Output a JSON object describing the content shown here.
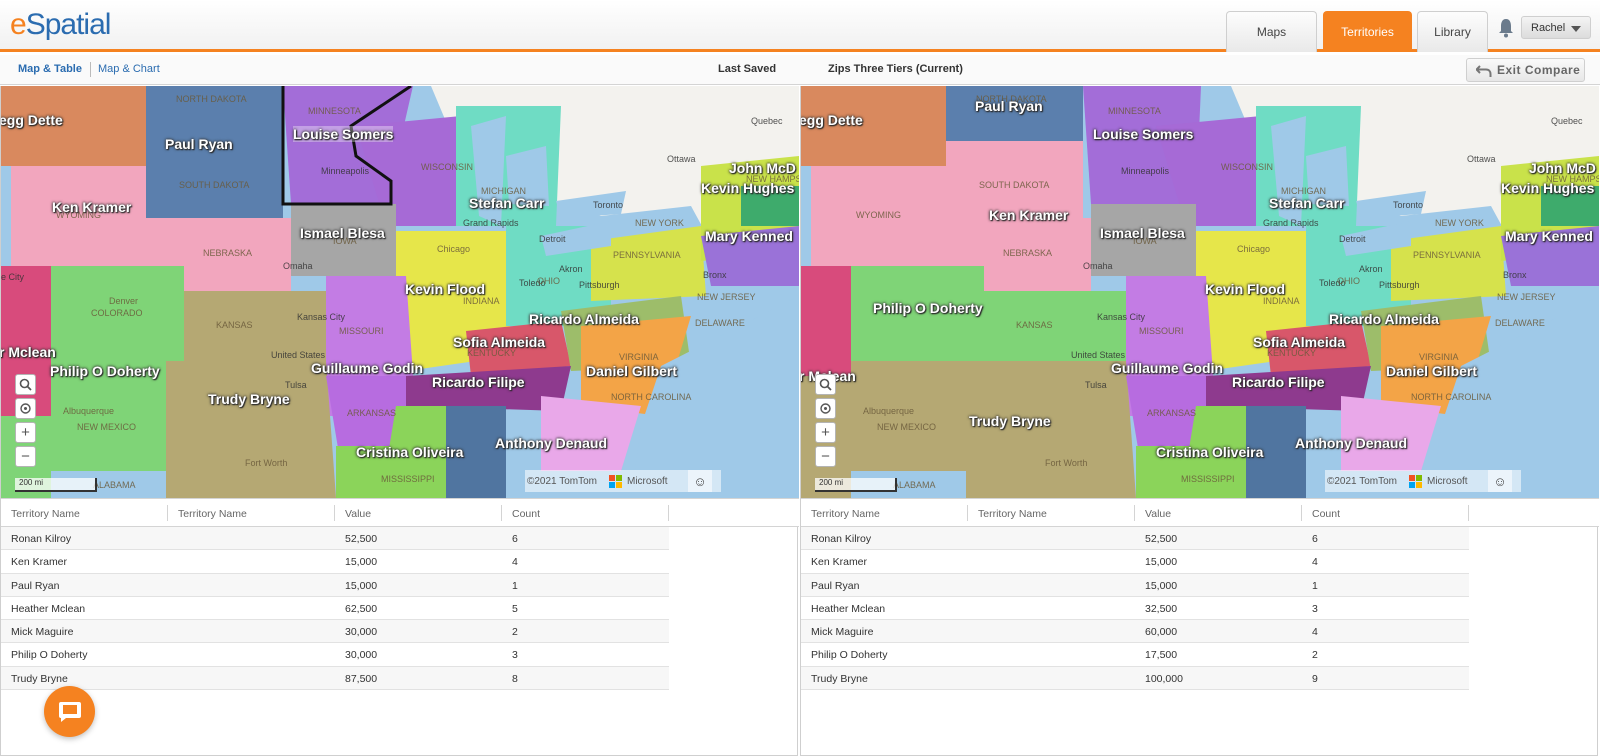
{
  "app": {
    "logo_part1": "e",
    "logo_part2": "Spatial",
    "brand_orange": "#f58220",
    "brand_blue": "#2b6cb0"
  },
  "nav": {
    "maps": "Maps",
    "territories": "Territories",
    "library": "Library",
    "active": "Territories",
    "user": "Rachel"
  },
  "subbar": {
    "tab_map_table": "Map & Table",
    "tab_map_chart": "Map & Chart",
    "last_saved": "Last Saved",
    "scenario": "Zips Three Tiers (Current)",
    "exit_compare": "Exit Compare"
  },
  "map": {
    "labels": [
      "egg Dette",
      "Paul Ryan",
      "Louise Somers",
      "Ken Kramer",
      "Stefan Carr",
      "Ismael Blesa",
      "Kevin Flood",
      "John McD",
      "Kevin Hughes",
      "Mary Kenned",
      "Ricardo Almeida",
      "Sofia Almeida",
      "r Mclean",
      "Philip O Doherty",
      "Guillaume Godin",
      "Ricardo Filipe",
      "Daniel Gilbert",
      "Trudy Bryne",
      "Anthony Denaud",
      "Cristina Oliveira"
    ],
    "cities": [
      "NORTH DAKOTA",
      "MINNESOTA",
      "SOUTH DAKOTA",
      "WYOMING",
      "Minneapolis",
      "WISCONSIN",
      "MICHIGAN",
      "Grand Rapids",
      "Detroit",
      "Toronto",
      "Ottawa",
      "Quebec",
      "NEW YORK",
      "NEW HAMPSHIRE",
      "NEBRASKA",
      "IOWA",
      "Omaha",
      "Chicago",
      "Toledo",
      "Akron",
      "OHIO",
      "PENNSYLVANIA",
      "Pittsburgh",
      "Bronx",
      "NEW JERSEY",
      "Denver",
      "COLORADO",
      "KANSAS",
      "Kansas City",
      "MISSOURI",
      "INDIANA",
      "KENTUCKY",
      "DELAWARE",
      "VIRGINIA",
      "United States",
      "Tulsa",
      "NORTH CAROLINA",
      "ARKANSAS",
      "Albuquerque",
      "NEW MEXICO",
      "Fort Worth",
      "MISSISSIPPI",
      "ALABAMA",
      "e City"
    ],
    "attribution": "©2021 TomTom",
    "microsoft": "Microsoft",
    "scale": "200 mi",
    "zoom_in": "+",
    "zoom_out": "−"
  },
  "table_headers": [
    "Territory Name",
    "Territory Name",
    "Value",
    "Count"
  ],
  "left_table": [
    {
      "name": "Ronan Kilroy",
      "value": "52,500",
      "count": "6"
    },
    {
      "name": "Ken Kramer",
      "value": "15,000",
      "count": "4"
    },
    {
      "name": "Paul Ryan",
      "value": "15,000",
      "count": "1"
    },
    {
      "name": "Heather Mclean",
      "value": "62,500",
      "count": "5"
    },
    {
      "name": "Mick Maguire",
      "value": "30,000",
      "count": "2"
    },
    {
      "name": "Philip O Doherty",
      "value": "30,000",
      "count": "3"
    },
    {
      "name": "Trudy Bryne",
      "value": "87,500",
      "count": "8"
    }
  ],
  "right_table": [
    {
      "name": "Ronan Kilroy",
      "value": "52,500",
      "count": "6"
    },
    {
      "name": "Ken Kramer",
      "value": "15,000",
      "count": "4"
    },
    {
      "name": "Paul Ryan",
      "value": "15,000",
      "count": "1"
    },
    {
      "name": "Heather Mclean",
      "value": "32,500",
      "count": "3"
    },
    {
      "name": "Mick Maguire",
      "value": "60,000",
      "count": "4"
    },
    {
      "name": "Philip O Doherty",
      "value": "17,500",
      "count": "2"
    },
    {
      "name": "Trudy Bryne",
      "value": "100,000",
      "count": "9"
    }
  ]
}
